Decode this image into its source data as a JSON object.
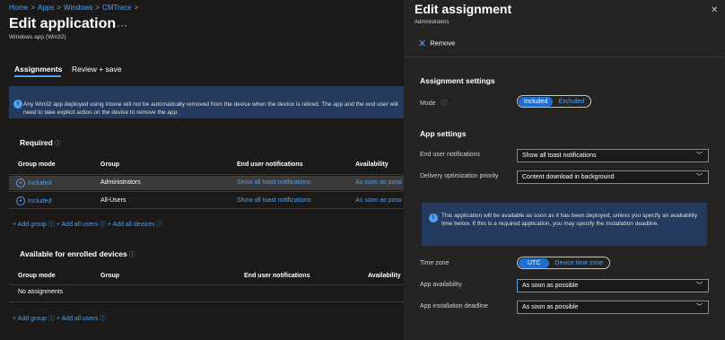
{
  "breadcrumb": [
    {
      "label": "Home"
    },
    {
      "label": "Apps"
    },
    {
      "label": "Windows"
    },
    {
      "label": "CMTrace"
    }
  ],
  "breadcrumb_sep": ">",
  "page": {
    "title": "Edit application",
    "more": "···",
    "subtitle": "Windows app (Win32)"
  },
  "tabs": [
    {
      "label": "Assignments",
      "active": true
    },
    {
      "label": "Review + save",
      "active": false
    }
  ],
  "info_banner": "Any Win32 app deployed using Intune will not be automatically removed from the device when the device is retired. The app and the end user will need to take explicit action on the device to remove the app.",
  "required": {
    "title": "Required",
    "info": "ⓘ",
    "columns": [
      "Group mode",
      "Group",
      "End user notifications",
      "Availability"
    ],
    "rows": [
      {
        "mode": "Included",
        "group": "Administrators",
        "notifications": "Show all toast notifications",
        "availability": "As soon as possible",
        "selected": true
      },
      {
        "mode": "Included",
        "group": "All-Users",
        "notifications": "Show all toast notifications",
        "availability": "As soon as possible",
        "selected": false
      }
    ],
    "add_links": [
      "+ Add group ⓘ",
      "+ Add all users ⓘ",
      "+ Add all devices ⓘ"
    ]
  },
  "available": {
    "title": "Available for enrolled devices",
    "info": "ⓘ",
    "columns": [
      "Group mode",
      "Group",
      "End user notifications",
      "Availability"
    ],
    "empty": "No assignments",
    "add_links": [
      "+ Add group ⓘ",
      "+ Add all users ⓘ"
    ]
  },
  "panel": {
    "title": "Edit assignment",
    "close": "✕",
    "subtitle": "Administrators",
    "remove": "Remove",
    "assignment_settings": "Assignment settings",
    "mode_label": "Mode",
    "mode_options": [
      "Included",
      "Excluded"
    ],
    "mode_selected": "Included",
    "app_settings": "App settings",
    "notif_label": "End user notifications",
    "notif_value": "Show all toast notifications",
    "delivery_label": "Delivery optimization priority",
    "delivery_value": "Content download in background",
    "banner": "This application will be available as soon as it has been deployed, unless you specify an availability time below. If this is a required application, you may specify the installation deadline.",
    "timezone_label": "Time zone",
    "timezone_options": [
      "UTC",
      "Device time zone"
    ],
    "timezone_selected": "UTC",
    "availability_label": "App availability",
    "availability_value": "As soon as possible",
    "deadline_label": "App installation deadline",
    "deadline_value": "As soon as possible"
  },
  "colors": {
    "accent": "#4ea1f3",
    "banner": "#243a5e",
    "selected_row": "#3b3a39",
    "toggle_on": "#1f6fd1"
  }
}
